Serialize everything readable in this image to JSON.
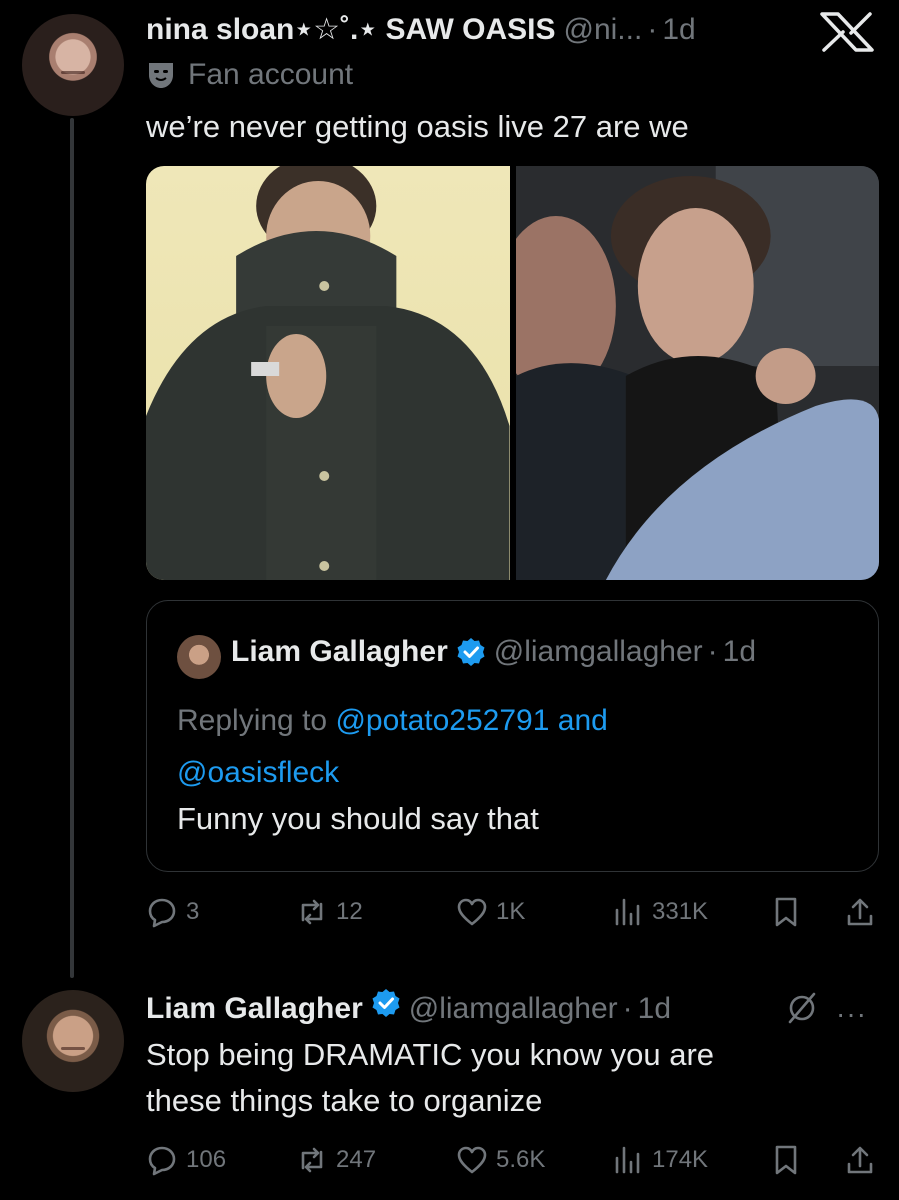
{
  "top_tweet": {
    "name": "nina sloan⋆☆˚.⋆ SAW OASIS",
    "handle": "@ni...",
    "separator": "·",
    "time": "1d",
    "label": "Fan account",
    "text": "we’re never getting oasis live 27 are we",
    "quote": {
      "name": "Liam Gallagher",
      "handle": "@liamgallagher",
      "separator": "·",
      "time": "1d",
      "replying_prefix": "Replying to",
      "mention1": "@potato252791",
      "and": "and",
      "mention2": "@oasisfleck",
      "text": "Funny you should say that"
    },
    "actions": {
      "replies": "3",
      "reposts": "12",
      "likes": "1K",
      "views": "331K"
    }
  },
  "reply_tweet": {
    "name": "Liam Gallagher",
    "handle": "@liamgallagher",
    "separator": "·",
    "time": "1d",
    "text_line1": "Stop being DRAMATIC you know you are",
    "text_line2": "these things take to organize",
    "more": "···",
    "actions": {
      "replies": "106",
      "reposts": "247",
      "likes": "5.6K",
      "views": "174K"
    }
  },
  "colors": {
    "background": "#000000",
    "text": "#e7e9ea",
    "muted": "#71767b",
    "link": "#1d9bf0",
    "verified": "#1d9bf0"
  }
}
